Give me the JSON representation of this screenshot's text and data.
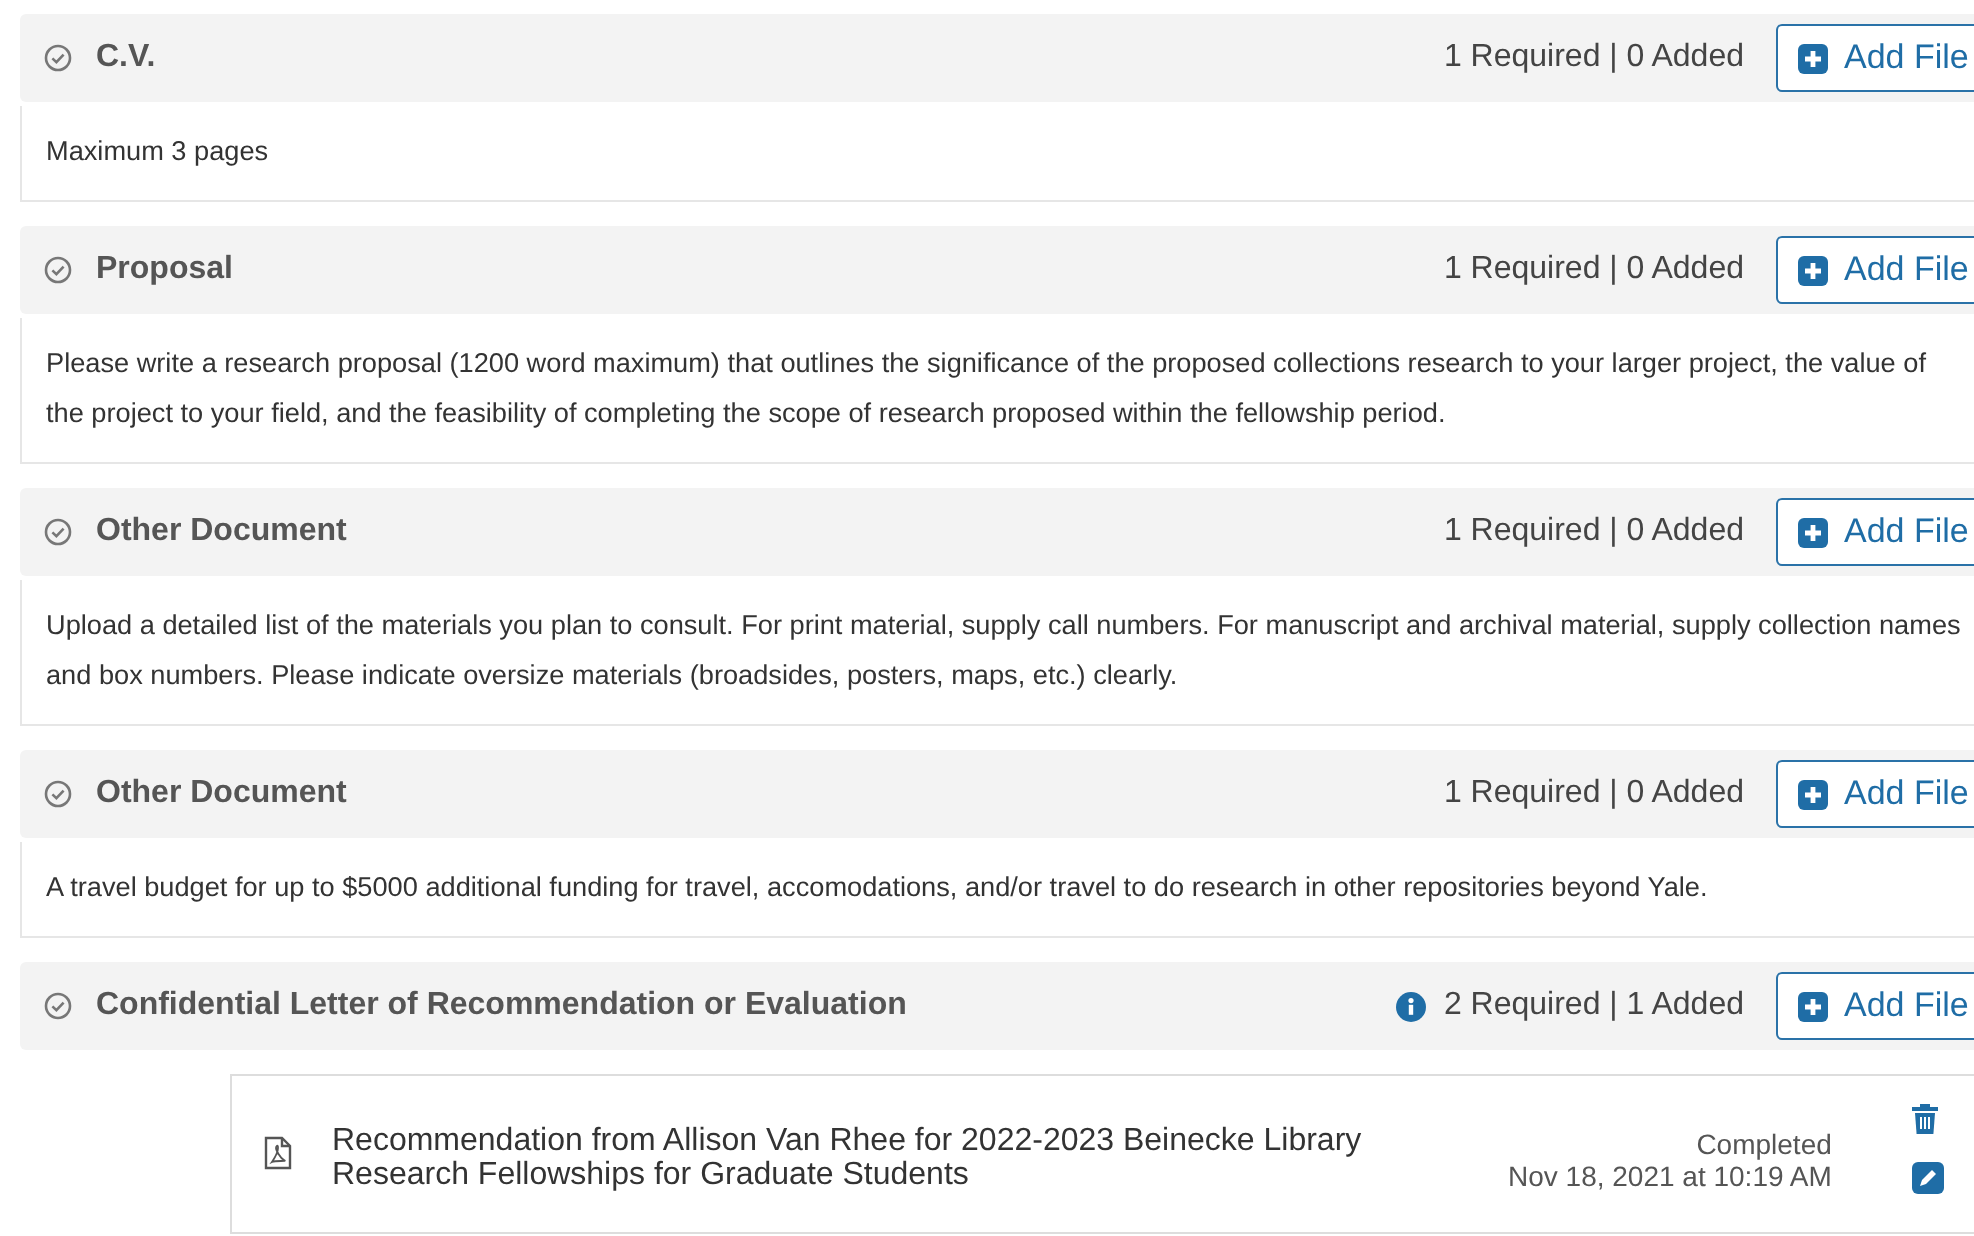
{
  "sections": [
    {
      "title": "C.V.",
      "info": false,
      "count": "1 Required | 0 Added",
      "button": "Add File",
      "description": "Maximum 3 pages"
    },
    {
      "title": "Proposal",
      "info": false,
      "count": "1 Required | 0 Added",
      "button": "Add File",
      "description": "Please write a research proposal (1200 word maximum) that outlines the significance of the proposed collections research to your larger project, the value of the project to your field, and the feasibility of completing the scope of research proposed within the fellowship period."
    },
    {
      "title": "Other Document",
      "info": false,
      "count": "1 Required | 0 Added",
      "button": "Add File",
      "description": "Upload a detailed list of the materials you plan to consult. For print material, supply call numbers. For manuscript and archival material, supply collection names and box numbers. Please indicate oversize materials (broadsides, posters, maps, etc.) clearly."
    },
    {
      "title": "Other Document",
      "info": false,
      "count": "1 Required | 0 Added",
      "button": "Add File",
      "description": "A travel budget for up to $5000 additional funding for travel, accomodations, and/or travel to do research in other repositories beyond Yale."
    },
    {
      "title": "Confidential Letter of Recommendation or Evaluation",
      "info": true,
      "count": "2 Required | 1 Added",
      "button": "Add File",
      "files": [
        {
          "name": "Recommendation from Allison Van Rhee for 2022-2023 Beinecke Library Research Fellowships for Graduate Students",
          "status": "Completed",
          "date": "Nov 18, 2021 at 10:19 AM"
        }
      ]
    }
  ]
}
